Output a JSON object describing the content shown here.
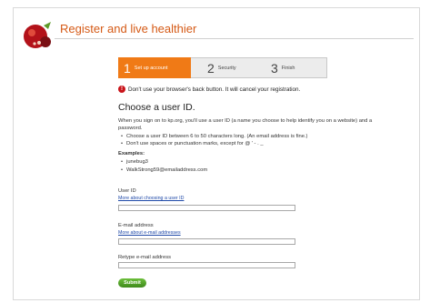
{
  "header": {
    "title": "Register and live healthier"
  },
  "steps": [
    {
      "num": "1",
      "label": "Set up account"
    },
    {
      "num": "2",
      "label": "Security"
    },
    {
      "num": "3",
      "label": "Finish"
    }
  ],
  "warning": "Don't use your browser's back button. It will cancel your registration.",
  "section": {
    "heading": "Choose a user ID.",
    "intro": "When you sign on to kp.org, you'll use a user ID (a name you choose to help identify you on a website) and a password.",
    "rules": [
      "Choose a user ID between 6 to 50 characters long. (An email address is fine.)",
      "Don't use spaces or punctuation marks, except for @ ' - . _"
    ],
    "examples_label": "Examples:",
    "examples": [
      "junebug3",
      "WalkStrong59@emailaddress.com"
    ]
  },
  "form": {
    "userid_label": "User ID",
    "userid_link": "More about choosing a user ID",
    "userid_value": "",
    "email_label": "E-mail address",
    "email_link": "More about e-mail addresses",
    "email_value": "",
    "retype_label": "Retype e-mail address",
    "retype_value": "",
    "submit_label": "Submit"
  },
  "colors": {
    "accent": "#f07a16",
    "title": "#d55a16",
    "link": "#1f49a8",
    "button": "#4f9d27",
    "warning": "#c9141a"
  }
}
